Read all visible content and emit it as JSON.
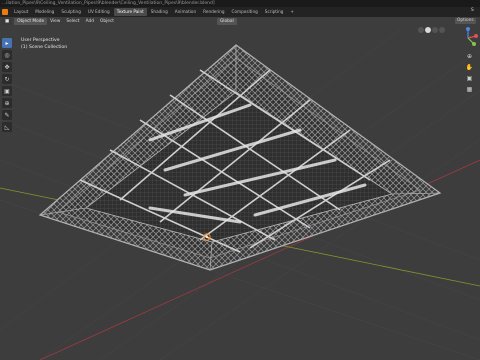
{
  "window": {
    "title": "...ilation_Pipes\\9\\Ceiling_Ventilation_Pipes\\9\\blender\\Ceiling_Ventilation_Pipes\\9\\blender.blend]"
  },
  "workspaces": [
    {
      "label": "Layout"
    },
    {
      "label": "Modeling"
    },
    {
      "label": "Sculpting"
    },
    {
      "label": "UV Editing"
    },
    {
      "label": "Texture Paint"
    },
    {
      "label": "Shading"
    },
    {
      "label": "Animation"
    },
    {
      "label": "Rendering"
    },
    {
      "label": "Compositing"
    },
    {
      "label": "Scripting"
    },
    {
      "label": "+"
    }
  ],
  "header": {
    "mode": "Object Mode",
    "menus": [
      "View",
      "Select",
      "Add",
      "Object"
    ],
    "transform": "Global",
    "options": "Options",
    "scene": "S"
  },
  "overlay": {
    "view_name": "User Perspective",
    "collection": "(1) Scene Collection"
  },
  "tools": [
    {
      "name": "select-tool-icon",
      "glyph": "▸"
    },
    {
      "name": "cursor-tool-icon",
      "glyph": "◎"
    },
    {
      "name": "move-tool-icon",
      "glyph": "✥"
    },
    {
      "name": "rotate-tool-icon",
      "glyph": "↻"
    },
    {
      "name": "scale-tool-icon",
      "glyph": "▣"
    },
    {
      "name": "transform-tool-icon",
      "glyph": "⊕"
    },
    {
      "name": "annotate-tool-icon",
      "glyph": "✎"
    },
    {
      "name": "measure-tool-icon",
      "glyph": "◺"
    }
  ],
  "navigation": [
    {
      "name": "zoom-icon",
      "glyph": "⊕"
    },
    {
      "name": "pan-hand-icon",
      "glyph": "✋"
    },
    {
      "name": "camera-icon",
      "glyph": "▣"
    },
    {
      "name": "grid-icon",
      "glyph": "▦"
    }
  ],
  "colors": {
    "x_axis": "#9b3a44",
    "y_axis": "#7f9a2c",
    "active_tab": "#4a4a4a",
    "tool_active": "#4772b3",
    "origin_marker": "#ff8a1f"
  }
}
